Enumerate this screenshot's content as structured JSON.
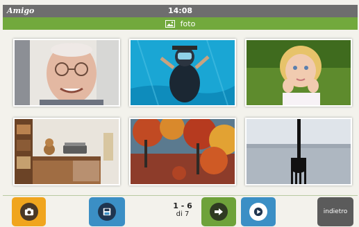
{
  "status_bar": {
    "brand": "Amigo",
    "time": "14:08"
  },
  "title_bar": {
    "icon": "image-icon",
    "title": "foto"
  },
  "photos": [
    {
      "subject": "elderly man portrait"
    },
    {
      "subject": "scuba diver underwater"
    },
    {
      "subject": "little girl on grass"
    },
    {
      "subject": "room with shelves and typewriter"
    },
    {
      "subject": "autumn trees with red leaves"
    },
    {
      "subject": "fork against lake sky"
    }
  ],
  "pager": {
    "range": "1 - 6",
    "total": "di 7"
  },
  "toolbar": {
    "camera_icon": "camera-icon",
    "save_icon": "save-icon",
    "next_icon": "arrow-right-icon",
    "play_icon": "play-icon",
    "back_label": "indietro"
  },
  "colors": {
    "status_bar": "#6e6e6e",
    "title_bar": "#72a93d",
    "camera_button": "#f0a51e",
    "save_button": "#3b8fc5",
    "next_button": "#6ea23a",
    "play_button": "#3b8fc5",
    "back_button": "#5b5b5b"
  }
}
